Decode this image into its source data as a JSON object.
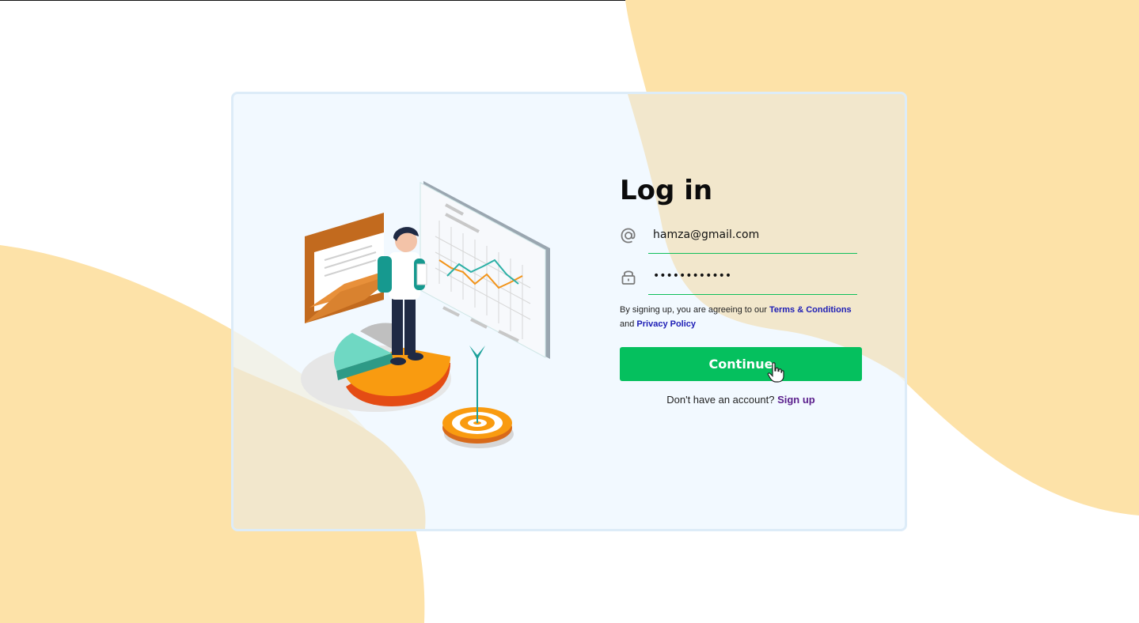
{
  "login": {
    "title": "Log in",
    "email_value": "hamza@gmail.com",
    "password_value": "••••••••••••",
    "email_icon": "at-sign-icon",
    "password_icon": "lock-icon",
    "terms_prefix": "By signing up, you are agreeing to our ",
    "terms_link": "Terms & Conditions",
    "terms_and": " and ",
    "privacy_link": "Privacy Policy",
    "continue_label": "Continue",
    "signup_prompt": "Don't have an account? ",
    "signup_link": "Sign up"
  },
  "colors": {
    "accent": "#05c05e",
    "link": "#1c1cb5",
    "signup": "#5a1e8c",
    "blob": "#fde2a8"
  },
  "illustration": "analytics-person-illustration"
}
